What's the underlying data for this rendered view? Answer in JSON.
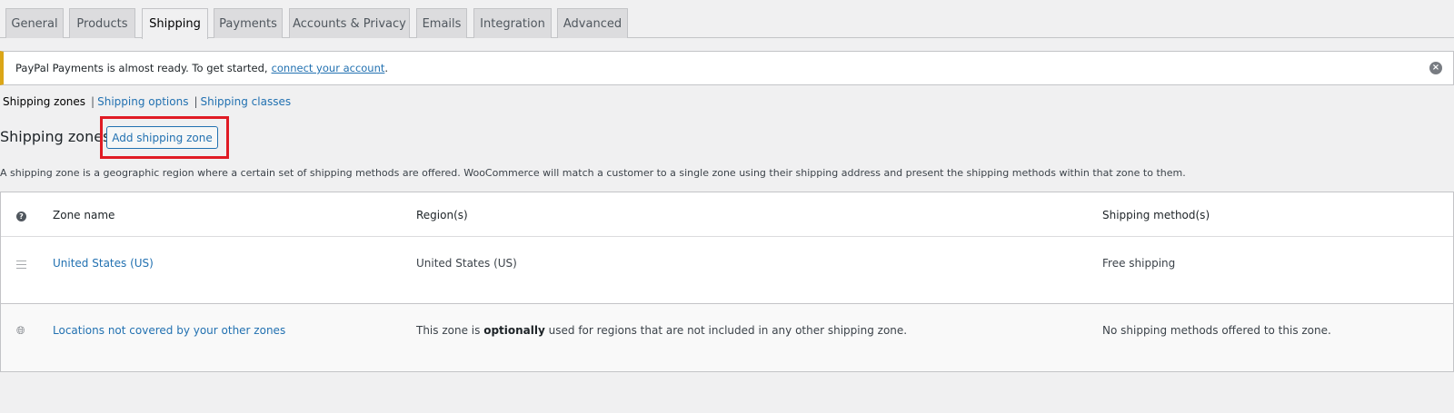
{
  "tabs": [
    {
      "label": "General"
    },
    {
      "label": "Products"
    },
    {
      "label": "Shipping"
    },
    {
      "label": "Payments"
    },
    {
      "label": "Accounts & Privacy"
    },
    {
      "label": "Emails"
    },
    {
      "label": "Integration"
    },
    {
      "label": "Advanced"
    }
  ],
  "notice": {
    "text": "PayPal Payments is almost ready. To get started,",
    "link": "connect your account",
    "after": "."
  },
  "subnav": {
    "current": "Shipping zones",
    "items": [
      "Shipping options",
      "Shipping classes"
    ],
    "separator": "|"
  },
  "page": {
    "title": "Shipping zones",
    "add_button": "Add shipping zone",
    "description": "A shipping zone is a geographic region where a certain set of shipping methods are offered. WooCommerce will match a customer to a single zone using their shipping address and present the shipping methods within that zone to them."
  },
  "table": {
    "headers": {
      "help": "?",
      "name": "Zone name",
      "region": "Region(s)",
      "methods": "Shipping method(s)"
    },
    "rows": [
      {
        "icon": "drag-handle-icon",
        "name": "United States (US)",
        "region": "United States (US)",
        "methods": "Free shipping"
      },
      {
        "icon": "globe-icon",
        "name": "Locations not covered by your other zones",
        "region_prefix": "This zone is",
        "region_bold": "optionally",
        "region_suffix": "used for regions that are not included in any other shipping zone.",
        "methods": "No shipping methods offered to this zone."
      }
    ]
  },
  "colors": {
    "accent": "#2271b1",
    "notice_border": "#dba617",
    "highlight": "#e01b24"
  }
}
